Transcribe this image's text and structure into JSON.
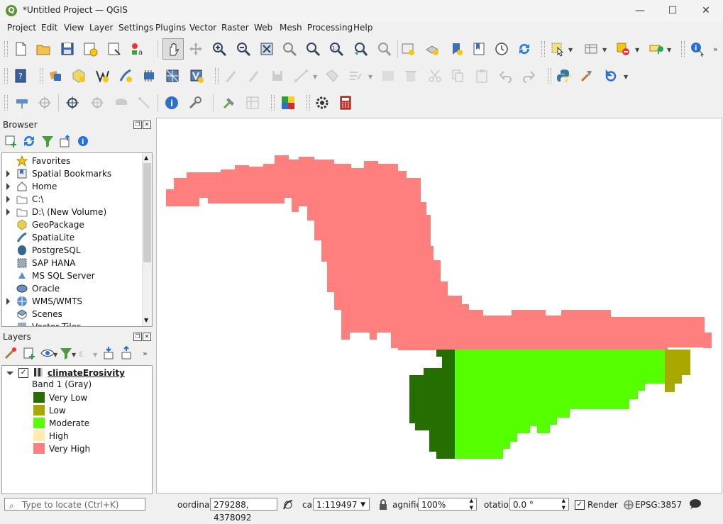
{
  "window": {
    "title": "*Untitled Project — QGIS",
    "app_icon_letter": "Q",
    "minimize": "—",
    "maximize": "☐",
    "close": "✕"
  },
  "menu": [
    "Project",
    "Edit",
    "View",
    "Layer",
    "Settings",
    "Plugins",
    "Vector",
    "Raster",
    "Web",
    "Mesh",
    "Processing",
    "Help"
  ],
  "browser": {
    "title": "Browser",
    "items": [
      {
        "label": "Favorites",
        "icon": "star-icon",
        "expandable": false
      },
      {
        "label": "Spatial Bookmarks",
        "icon": "bookmark-icon",
        "expandable": true
      },
      {
        "label": "Home",
        "icon": "home-icon",
        "expandable": true
      },
      {
        "label": "C:\\",
        "icon": "folder-icon",
        "expandable": true
      },
      {
        "label": "D:\\ (New Volume)",
        "icon": "folder-icon",
        "expandable": true
      },
      {
        "label": "GeoPackage",
        "icon": "geopackage-icon",
        "expandable": false
      },
      {
        "label": "SpatiaLite",
        "icon": "spatialite-icon",
        "expandable": false
      },
      {
        "label": "PostgreSQL",
        "icon": "postgresql-icon",
        "expandable": false
      },
      {
        "label": "SAP HANA",
        "icon": "sap-hana-icon",
        "expandable": false
      },
      {
        "label": "MS SQL Server",
        "icon": "mssql-icon",
        "expandable": false
      },
      {
        "label": "Oracle",
        "icon": "oracle-icon",
        "expandable": false
      },
      {
        "label": "WMS/WMTS",
        "icon": "wms-icon",
        "expandable": true
      },
      {
        "label": "Scenes",
        "icon": "scenes-icon",
        "expandable": false
      },
      {
        "label": "Vector Tiles",
        "icon": "vector-tiles-icon",
        "expandable": false
      }
    ]
  },
  "layers": {
    "title": "Layers",
    "layer_name": "climateErosivity",
    "checked": true,
    "band": "Band 1 (Gray)",
    "legend": [
      {
        "label": "Very Low",
        "color": "#246f00"
      },
      {
        "label": "Low",
        "color": "#a8a800"
      },
      {
        "label": "Moderate",
        "color": "#55ff00"
      },
      {
        "label": "High",
        "color": "#ffebaf"
      },
      {
        "label": "Very High",
        "color": "#ff7f7f"
      }
    ]
  },
  "statusbar": {
    "locate_placeholder": "Type to locate (Ctrl+K)",
    "coord_label": "oordinat",
    "coord_value": "279288, 4378092",
    "scale_label": "cal",
    "scale_value": "1:119497",
    "magnifier_label": "agnifie",
    "magnifier_value": "100%",
    "rotation_label": "otatio",
    "rotation_value": "0.0 °",
    "render_label": "Render",
    "render_checked": true,
    "crs": "EPSG:3857"
  },
  "map_colors": {
    "very_high": "#ff7f7f",
    "moderate": "#55ff00",
    "very_low": "#246f00",
    "low": "#a8a800"
  }
}
